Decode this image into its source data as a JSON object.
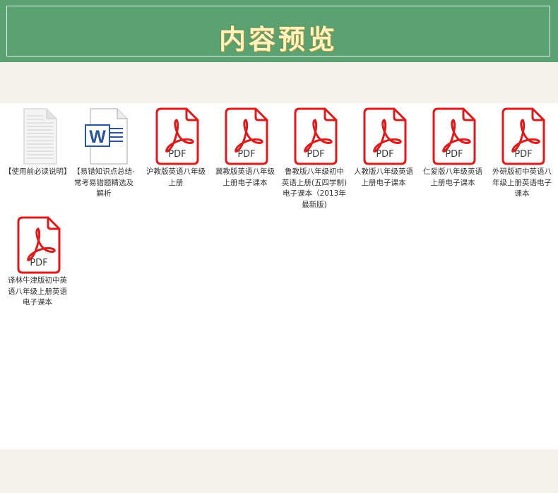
{
  "header": {
    "title": "内容预览"
  },
  "files": [
    {
      "type": "txt",
      "icon": "text-document-icon",
      "name": "【使用前必读说明】"
    },
    {
      "type": "word",
      "icon": "word-document-icon",
      "name": "【易错知识点总结-常考易错题精选及解析"
    },
    {
      "type": "pdf",
      "icon": "pdf-file-icon",
      "badge": "PDF",
      "name": "沪教版英语八年级上册"
    },
    {
      "type": "pdf",
      "icon": "pdf-file-icon",
      "badge": "PDF",
      "name": "冀教版英语八年级上册电子课本"
    },
    {
      "type": "pdf",
      "icon": "pdf-file-icon",
      "badge": "PDF",
      "name": "鲁教版八年级初中英语上册(五四学制)电子课本（2013年最新版)"
    },
    {
      "type": "pdf",
      "icon": "pdf-file-icon",
      "badge": "PDF",
      "name": "人教版八年级英语上册电子课本"
    },
    {
      "type": "pdf",
      "icon": "pdf-file-icon",
      "badge": "PDF",
      "name": "仁爱版八年级英语上册电子课本"
    },
    {
      "type": "pdf",
      "icon": "pdf-file-icon",
      "badge": "PDF",
      "name": "外研版初中英语八年级上册英语电子课本"
    },
    {
      "type": "pdf",
      "icon": "pdf-file-icon",
      "badge": "PDF",
      "name": "译林牛津版初中英语八年级上册英语电子课本"
    }
  ],
  "colors": {
    "banner": "#5aa271",
    "pdf_red": "#e0191b",
    "word_blue": "#2a5699"
  }
}
